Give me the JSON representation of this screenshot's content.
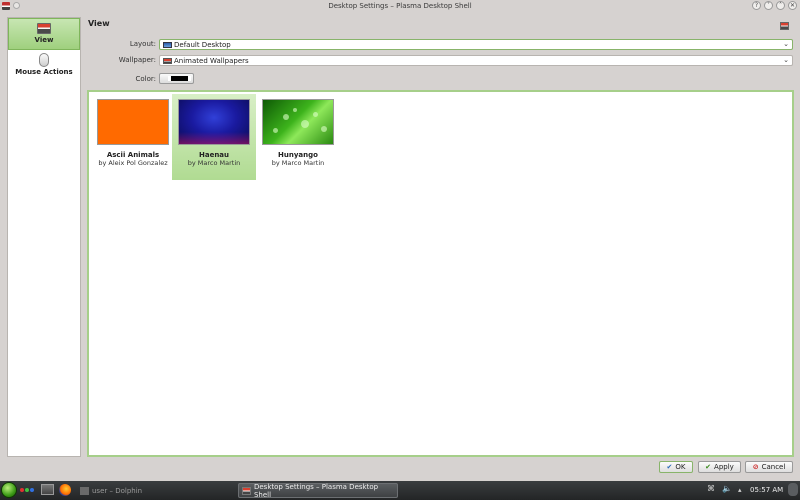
{
  "window": {
    "title": "Desktop Settings – Plasma Desktop Shell"
  },
  "sidebar": {
    "items": [
      {
        "label": "View",
        "icon": "desktop-icon",
        "active": true
      },
      {
        "label": "Mouse Actions",
        "icon": "mouse-icon",
        "active": false
      }
    ]
  },
  "view": {
    "title": "View",
    "layout_label": "Layout:",
    "layout_value": "Default Desktop",
    "wallpaper_label": "Wallpaper:",
    "wallpaper_value": "Animated Wallpapers",
    "color_label": "Color:"
  },
  "wallpapers": [
    {
      "name": "Ascii Animals",
      "author": "by Aleix Pol Gonzalez",
      "selected": false
    },
    {
      "name": "Haenau",
      "author": "by Marco Martin",
      "selected": true
    },
    {
      "name": "Hunyango",
      "author": "by Marco Martin",
      "selected": false
    }
  ],
  "buttons": {
    "ok": "OK",
    "apply": "Apply",
    "cancel": "Cancel"
  },
  "taskbar": {
    "tasks": [
      {
        "label": "user – Dolphin",
        "active": false
      },
      {
        "label": "Desktop Settings – Plasma Desktop Shell",
        "active": true
      }
    ],
    "clock": "05:57 AM"
  },
  "colors": {
    "accent_green": "#9fd07e",
    "selection_border": "#88b46a",
    "ascii_thumb": "#ff6a00"
  }
}
